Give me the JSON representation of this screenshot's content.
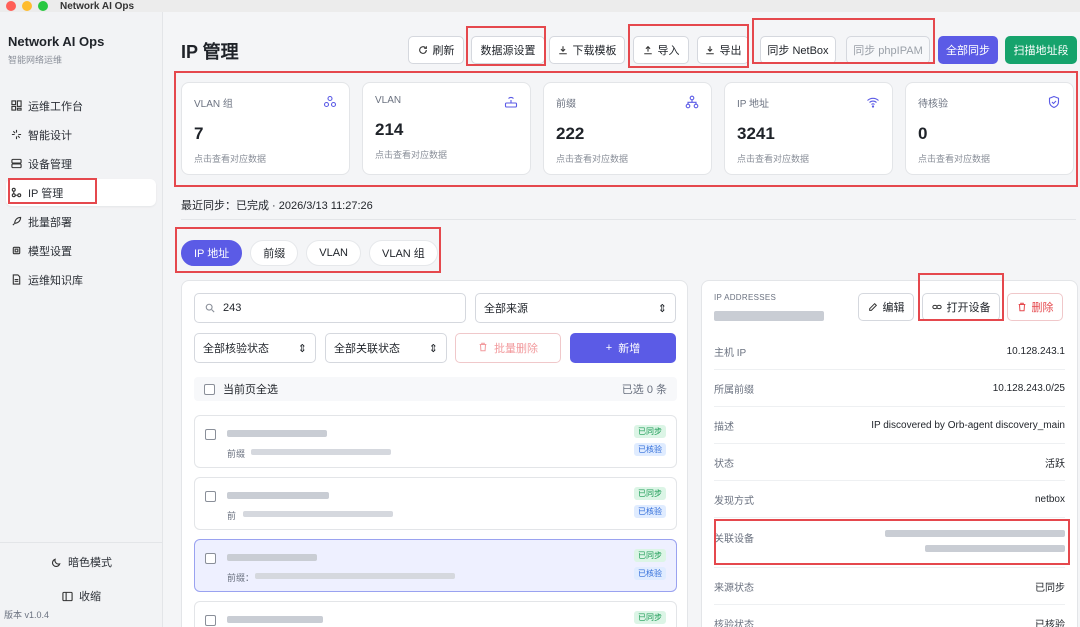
{
  "app": {
    "title": "Network AI Ops"
  },
  "sidebar": {
    "brand": "Network AI Ops",
    "subtitle": "智能网络运维",
    "items": [
      {
        "label": "运维工作台",
        "icon": "dashboard-icon"
      },
      {
        "label": "智能设计",
        "icon": "design-icon"
      },
      {
        "label": "设备管理",
        "icon": "server-icon"
      },
      {
        "label": "IP 管理",
        "icon": "network-icon",
        "active": true
      },
      {
        "label": "批量部署",
        "icon": "rocket-icon"
      },
      {
        "label": "模型设置",
        "icon": "chip-icon"
      },
      {
        "label": "运维知识库",
        "icon": "document-icon"
      }
    ],
    "dark_mode": "暗色模式",
    "collapse": "收缩",
    "version": "版本 v1.0.4"
  },
  "header": {
    "title": "IP 管理",
    "buttons": {
      "refresh": "刷新",
      "datasource": "数据源设置",
      "download_template": "下载模板",
      "import": "导入",
      "export": "导出",
      "sync_netbox": "同步 NetBox",
      "sync_phpipam": "同步 phpIPAM",
      "sync_all": "全部同步",
      "scan": "扫描地址段"
    }
  },
  "stats": [
    {
      "label": "VLAN 组",
      "value": "7",
      "hint": "点击查看对应数据",
      "icon": "cluster-icon"
    },
    {
      "label": "VLAN",
      "value": "214",
      "hint": "点击查看对应数据",
      "icon": "router-icon"
    },
    {
      "label": "前缀",
      "value": "222",
      "hint": "点击查看对应数据",
      "icon": "hierarchy-icon"
    },
    {
      "label": "IP 地址",
      "value": "3241",
      "hint": "点击查看对应数据",
      "icon": "wifi-icon"
    },
    {
      "label": "待核验",
      "value": "0",
      "hint": "点击查看对应数据",
      "icon": "shield-icon"
    }
  ],
  "sync": {
    "text": "最近同步：已完成 · 2026/3/13 11:27:26"
  },
  "tabs": [
    "IP 地址",
    "前缀",
    "VLAN",
    "VLAN 组"
  ],
  "list": {
    "search_value": "243",
    "source_filter": "全部来源",
    "verify_filter": "全部核验状态",
    "link_filter": "全部关联状态",
    "batch_delete": "批量删除",
    "add": "新增",
    "select_all": "当前页全选",
    "selected_count": "已选 0 条",
    "rows": [
      {
        "prefix_label": "前缀",
        "badge1": "已同步",
        "badge2": "已核验"
      },
      {
        "prefix_label": "前",
        "badge1": "已同步",
        "badge2": "已核验"
      },
      {
        "prefix_label": "前缀：",
        "badge1": "已同步",
        "badge2": "已核验"
      },
      {
        "prefix_label": "",
        "badge1": "已同步",
        "badge2": ""
      }
    ]
  },
  "detail": {
    "header": "IP ADDRESSES",
    "edit": "编辑",
    "open_device": "打开设备",
    "delete": "删除",
    "fields": [
      {
        "key": "主机 IP",
        "value": "10.128.243.1"
      },
      {
        "key": "所属前缀",
        "value": "10.128.243.0/25"
      },
      {
        "key": "描述",
        "value": "IP discovered by Orb-agent discovery_main"
      },
      {
        "key": "状态",
        "value": "活跃"
      },
      {
        "key": "发现方式",
        "value": "netbox"
      },
      {
        "key": "关联设备",
        "value": ""
      },
      {
        "key": "来源状态",
        "value": "已同步"
      },
      {
        "key": "核验状态",
        "value": "已核验"
      }
    ]
  },
  "colors": {
    "primary": "#5b5be6",
    "success": "#16a36c",
    "danger": "#e5484d",
    "highlight": "#e5484d"
  }
}
